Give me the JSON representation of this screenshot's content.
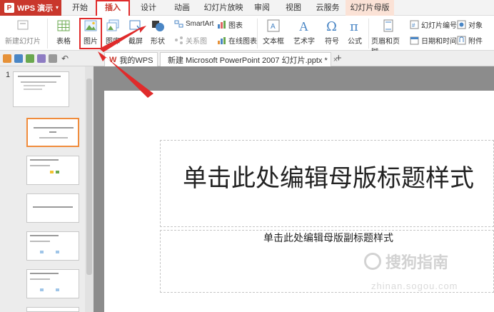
{
  "app": {
    "name": "WPS 演示"
  },
  "menu": {
    "tabs": [
      "开始",
      "插入",
      "设计",
      "动画",
      "幻灯片放映",
      "审阅",
      "视图",
      "云服务",
      "幻灯片母版"
    ],
    "active": "插入"
  },
  "ribbon": {
    "new_slide": "新建幻灯片",
    "table": "表格",
    "picture": "图片",
    "gallery": "图库",
    "screenshot": "截屏",
    "shape": "形状",
    "smartart": "SmartArt",
    "chart": "图表",
    "relation": "关系图",
    "online_chart": "在线图表",
    "textbox": "文本框",
    "wordart": "艺术字",
    "symbol": "符号",
    "formula": "公式",
    "header_footer": "页眉和页脚",
    "slide_number": "幻灯片编号",
    "date_time": "日期和时间",
    "object": "对象",
    "attachment": "附件"
  },
  "doc_tabs": {
    "my_wps": "我的WPS",
    "document": "新建 Microsoft PowerPoint 2007 幻灯片.pptx *"
  },
  "slides_panel": {
    "slide_number": "1"
  },
  "slide": {
    "title": "单击此处编辑母版标题样式",
    "subtitle": "单击此处编辑母版副标题样式"
  },
  "watermark": {
    "brand": "搜狗指南",
    "url": "zhinan.sogou.com"
  },
  "colors": {
    "brand": "#c9372c",
    "highlight": "#e02b2b",
    "master_tab": "#fbe2d6"
  }
}
